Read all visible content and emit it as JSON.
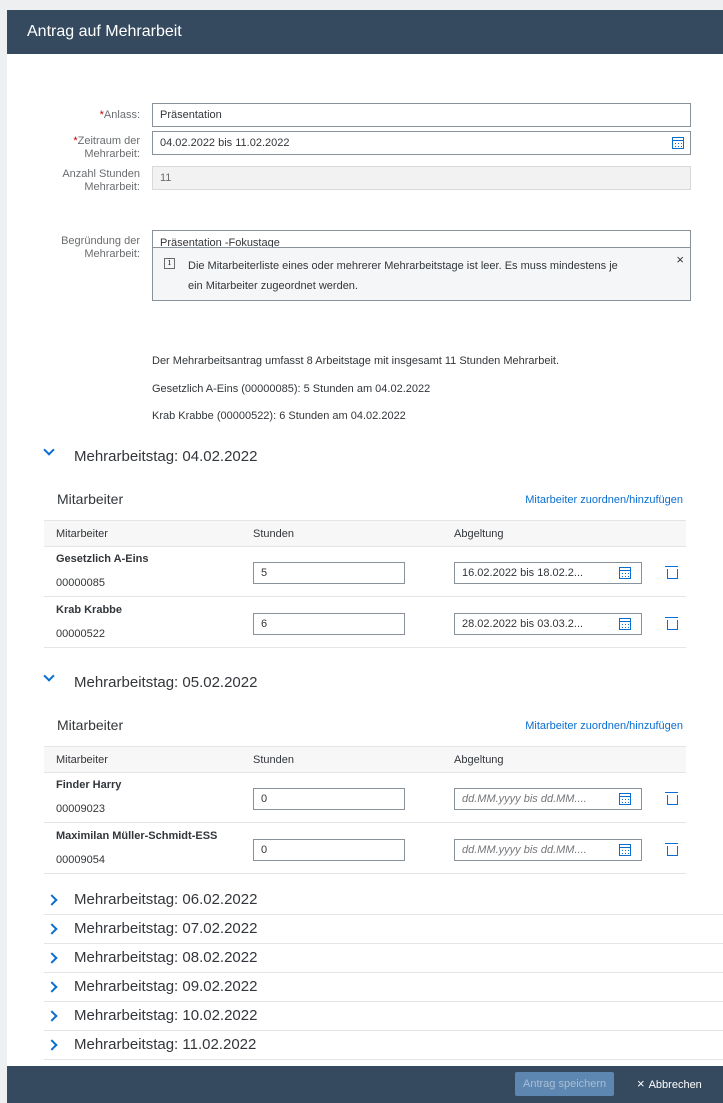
{
  "dialog": {
    "title": "Antrag auf Mehrarbeit"
  },
  "form": {
    "anlass": {
      "label": "Anlass:",
      "required": "*",
      "value": "Präsentation"
    },
    "zeitraum": {
      "label_line1": "Zeitraum der",
      "label_line2": "Mehrarbeit:",
      "required": "*",
      "value": "04.02.2022  bis  11.02.2022"
    },
    "stunden": {
      "label_line1": "Anzahl Stunden",
      "label_line2": "Mehrarbeit:",
      "value": "11"
    },
    "begruendung": {
      "label_line1": "Begründung der",
      "label_line2": "Mehrarbeit:",
      "value": "Präsentation -Fokustage"
    }
  },
  "message": {
    "icon": "info-icon",
    "line1": "Die Mitarbeiterliste eines oder mehrerer Mehrarbeitstage ist leer. Es muss mindestens je",
    "line2": "ein Mitarbeiter zugeordnet werden.",
    "close": "×"
  },
  "info": {
    "summary": "Der Mehrarbeitsantrag umfasst 8 Arbeitstage mit insgesamt 11 Stunden Mehrarbeit.",
    "line2": "Gesetzlich A-Eins (00000085): 5 Stunden am 04.02.2022",
    "line3": "Krab Krabbe (00000522): 6 Stunden am 04.02.2022"
  },
  "days_expanded": [
    {
      "title": "Mehrarbeitstag: 04.02.2022",
      "section": "Mitarbeiter",
      "link": "Mitarbeiter zuordnen/hinzufügen",
      "columns": [
        "Mitarbeiter",
        "Stunden",
        "Abgeltung"
      ],
      "rows": [
        {
          "name": "Gesetzlich A-Eins",
          "nr": "00000085",
          "hours": "5",
          "abgeltung": "16.02.2022  bis  18.02.2..."
        },
        {
          "name": "Krab Krabbe",
          "nr": "00000522",
          "hours": "6",
          "abgeltung": "28.02.2022  bis  03.03.2..."
        }
      ]
    },
    {
      "title": "Mehrarbeitstag: 05.02.2022",
      "section": "Mitarbeiter",
      "link": "Mitarbeiter zuordnen/hinzufügen",
      "columns": [
        "Mitarbeiter",
        "Stunden",
        "Abgeltung"
      ],
      "rows": [
        {
          "name": "Finder Harry",
          "nr": "00009023",
          "hours": "0",
          "abgeltung": "dd.MM.yyyy  bis  dd.MM...."
        },
        {
          "name": "Maximilan Müller-Schmidt-ESS",
          "nr": "00009054",
          "hours": "0",
          "abgeltung": "dd.MM.yyyy  bis  dd.MM...."
        }
      ]
    }
  ],
  "days_collapsed": [
    "Mehrarbeitstag: 06.02.2022",
    "Mehrarbeitstag: 07.02.2022",
    "Mehrarbeitstag: 08.02.2022",
    "Mehrarbeitstag: 09.02.2022",
    "Mehrarbeitstag: 10.02.2022",
    "Mehrarbeitstag: 11.02.2022"
  ],
  "footer": {
    "save": "Antrag speichern",
    "cancel": "Abbrechen",
    "cancel_icon": "×"
  },
  "colors": {
    "header": "#354a5f",
    "accent": "#0a6ed1",
    "required": "#bb0000"
  }
}
